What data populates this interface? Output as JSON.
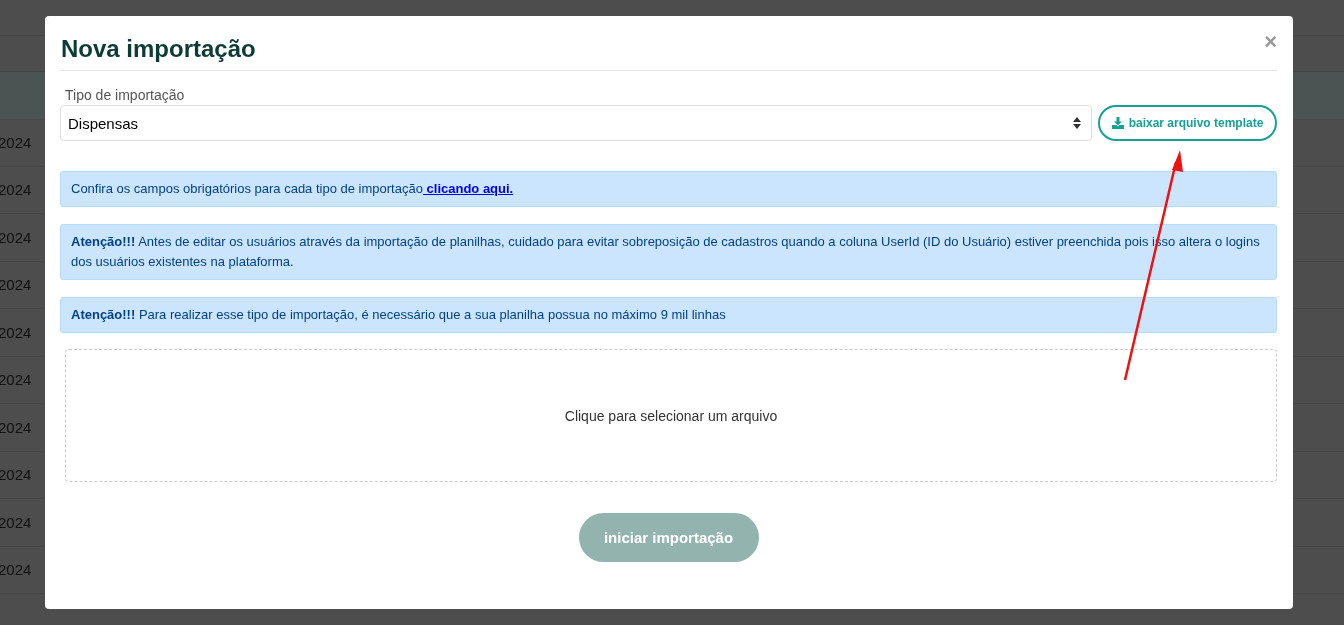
{
  "background_table": {
    "rows": [
      "2024",
      "2024",
      "2024",
      "2024",
      "2024",
      "2024",
      "2024",
      "2024",
      "2024",
      "2024"
    ]
  },
  "modal": {
    "title": "Nova importação",
    "close": "×",
    "field": {
      "label": "Tipo de importação",
      "value": "Dispensas"
    },
    "template_button": {
      "label": "baixar arquivo template"
    },
    "alerts": [
      {
        "text": "Confira os campos obrigatórios para cada tipo de importação",
        "link": " clicando aqui."
      },
      {
        "text": "**Atenção!!!** Antes de editar os usuários através da importação de planilhas, cuidado para evitar sobreposição de cadastros quando a coluna UserId (ID do Usuário) estiver preenchida pois isso altera o logins dos usuários existentes na plataforma."
      },
      {
        "text": "**Atenção!!!** Para realizar esse tipo de importação, é necessário que a sua planilha possua no máximo 9 mil linhas"
      }
    ],
    "dropzone": {
      "text": "Clique para selecionar um arquivo"
    },
    "submit": {
      "label": "iniciar importação",
      "disabled": true
    }
  }
}
